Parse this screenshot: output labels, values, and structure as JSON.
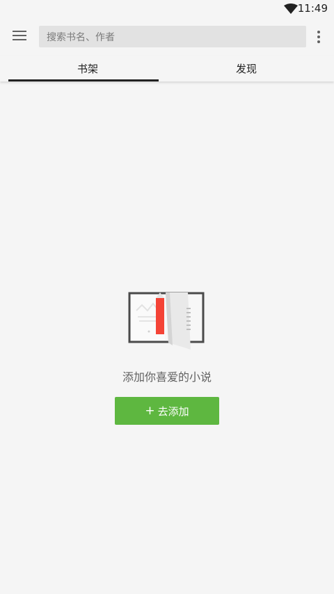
{
  "status_bar": {
    "time": "11:49",
    "wifi_icon": "wifi-icon"
  },
  "toolbar": {
    "menu_icon": "menu-icon",
    "search_placeholder": "搜索书名、作者",
    "more_icon": "more-vert-icon"
  },
  "tabs": [
    {
      "label": "书架",
      "selected": true
    },
    {
      "label": "发现",
      "selected": false
    }
  ],
  "empty_state": {
    "illustration": "open-book-illustration",
    "message": "添加你喜爱的小说",
    "button_icon": "+",
    "button_label": "去添加"
  },
  "colors": {
    "background": "#f5f5f5",
    "accent": "#5eb740",
    "bookmark": "#f44336",
    "indicator": "#212121"
  }
}
